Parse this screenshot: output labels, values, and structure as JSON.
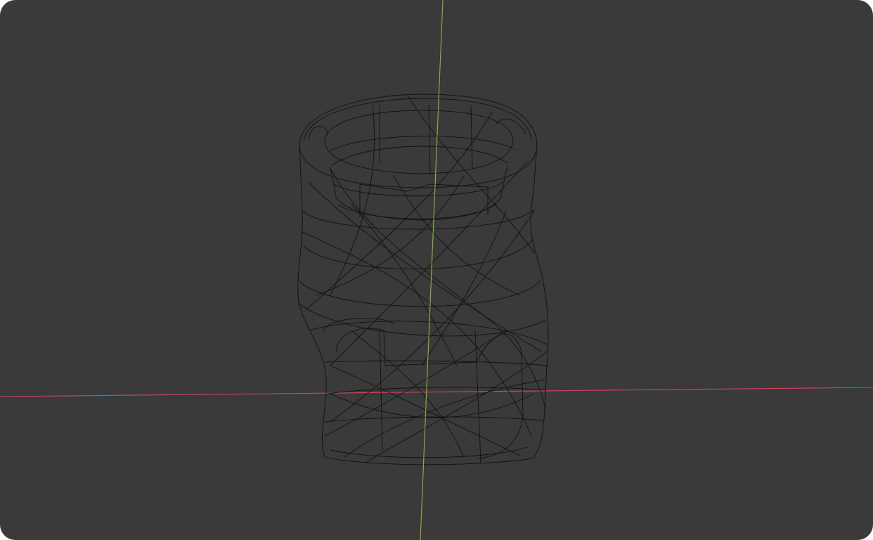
{
  "viewport": {
    "background_color": "#3a3a3a",
    "display_mode": "wireframe",
    "axes": {
      "x_axis_color": "#d0485a",
      "y_axis_color": "#86b83c"
    },
    "object": {
      "kind": "twisted-cylinder-mesh",
      "wire_color": "#111111"
    }
  }
}
